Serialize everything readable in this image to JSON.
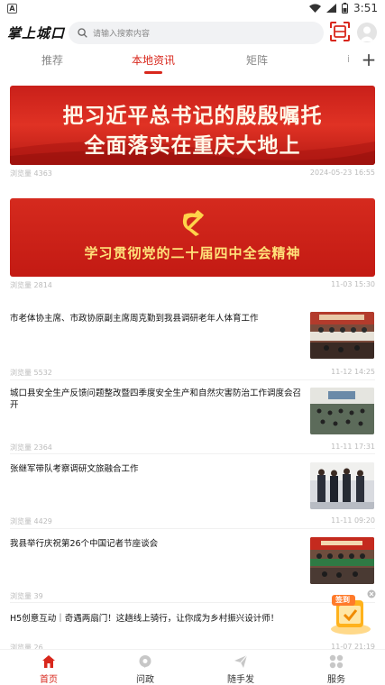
{
  "status_bar": {
    "time": "3:51",
    "left_badge": "A"
  },
  "header": {
    "logo_text": "掌上城口",
    "search_placeholder": "请输入搜索内容"
  },
  "tabs": [
    {
      "label": "推荐",
      "active": false
    },
    {
      "label": "本地资讯",
      "active": true
    },
    {
      "label": "矩阵",
      "active": false
    }
  ],
  "tab_more_glyph": "i",
  "banners": [
    {
      "lines": [
        "把习近平总书记的殷殷嘱托",
        "全面落实在重庆大地上"
      ],
      "views": "浏览量 4363",
      "date": "2024-05-23 16:55"
    },
    {
      "lines": [
        "学习贯彻党的二十届四中全会精神"
      ],
      "views": "浏览量 2814",
      "date": "11-03 15:30"
    }
  ],
  "news": [
    {
      "title": "市老体协主席、市政协原副主席周克勤到我县调研老年人体育工作",
      "views": "浏览量 5532",
      "date": "11-12 14:25",
      "has_thumb": true
    },
    {
      "title": "城口县安全生产反馈问题整改暨四季度安全生产和自然灾害防治工作调度会召开",
      "views": "浏览量 2364",
      "date": "11-11 17:31",
      "has_thumb": true
    },
    {
      "title": "张继军带队考察调研文旅融合工作",
      "views": "浏览量 4429",
      "date": "11-11 09:20",
      "has_thumb": true
    },
    {
      "title": "我县举行庆祝第26个中国记者节座谈会",
      "views": "浏览量 39",
      "date": "",
      "has_thumb": true
    },
    {
      "title": "H5创意互动｜奇遇两扇门！这趟线上骑行，让你成为乡村振兴设计师！",
      "views": "浏览量 26",
      "date": "11-07 21:19",
      "has_thumb": false
    }
  ],
  "floating": {
    "label": "签到"
  },
  "bottom_nav": [
    {
      "label": "首页",
      "icon": "home-icon",
      "active": true
    },
    {
      "label": "问政",
      "icon": "chat-icon",
      "active": false
    },
    {
      "label": "随手发",
      "icon": "send-icon",
      "active": false
    },
    {
      "label": "服务",
      "icon": "grid-icon",
      "active": false
    }
  ],
  "colors": {
    "accent": "#d8271c",
    "banner_red": "#c9201a",
    "gold_text": "#ffe27a"
  }
}
